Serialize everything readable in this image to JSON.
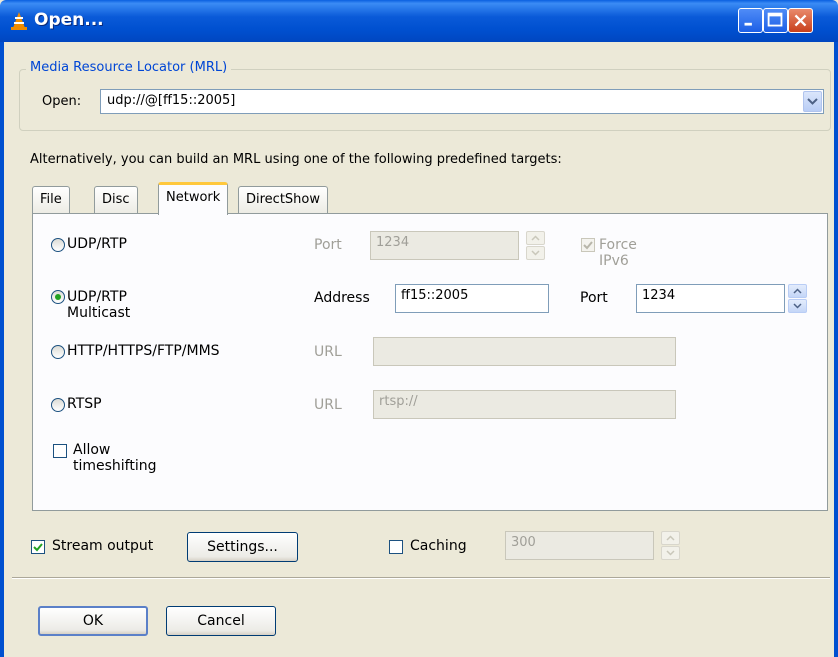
{
  "window": {
    "title": "Open...",
    "icon": "vlc-cone-icon"
  },
  "mrl": {
    "group_label": "Media Resource Locator (MRL)",
    "open_label": "Open:",
    "open_value": "udp://@[ff15::2005]"
  },
  "alt_text": "Alternatively, you can build an MRL using one of the following predefined targets:",
  "tabs": [
    {
      "label": "File",
      "active": false
    },
    {
      "label": "Disc",
      "active": false
    },
    {
      "label": "Network",
      "active": true
    },
    {
      "label": "DirectShow",
      "active": false
    }
  ],
  "network": {
    "udp": {
      "label": "UDP/RTP",
      "port_label": "Port",
      "port_value": "1234",
      "force_ipv6_label": "Force IPv6",
      "force_ipv6_checked": true,
      "selected": false
    },
    "multicast": {
      "label": "UDP/RTP Multicast",
      "address_label": "Address",
      "address_value": "ff15::2005",
      "port_label": "Port",
      "port_value": "1234",
      "selected": true
    },
    "http": {
      "label": "HTTP/HTTPS/FTP/MMS",
      "url_label": "URL",
      "url_value": "",
      "selected": false
    },
    "rtsp": {
      "label": "RTSP",
      "url_label": "URL",
      "url_value": "rtsp://",
      "selected": false
    },
    "timeshift": {
      "label": "Allow timeshifting",
      "checked": false
    }
  },
  "bottom": {
    "stream_output_label": "Stream output",
    "stream_output_checked": true,
    "settings_label": "Settings...",
    "caching_label": "Caching",
    "caching_checked": false,
    "caching_value": "300"
  },
  "buttons": {
    "ok": "OK",
    "cancel": "Cancel"
  },
  "colors": {
    "titlebar": "#0050d0",
    "accent_tab": "#ffc83c",
    "group_label": "#0046d5",
    "check": "#21a121"
  }
}
